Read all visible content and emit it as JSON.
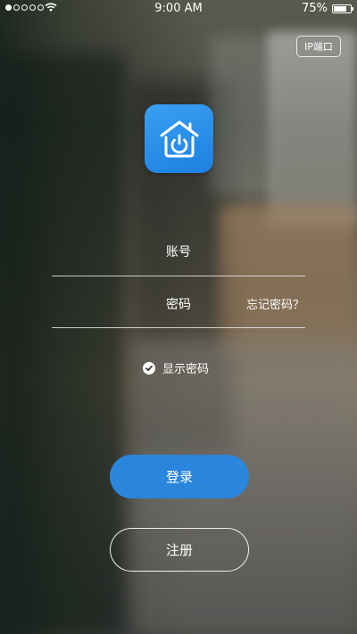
{
  "status_bar": {
    "time": "9:00 AM",
    "battery_percent": "75%",
    "battery_level": 0.75,
    "signal_dots_filled": 1,
    "signal_dots_total": 5
  },
  "header": {
    "ip_port_label": "IP端口"
  },
  "app_icon": {
    "icon": "home-power-icon",
    "color": "#2a86dc"
  },
  "form": {
    "account_label": "账号",
    "password_label": "密码",
    "forgot_password_label": "忘记密码？",
    "show_password_label": "显示密码",
    "show_password_checked": true
  },
  "actions": {
    "login_label": "登录",
    "register_label": "注册"
  },
  "colors": {
    "primary": "#2a86dc",
    "text": "#ffffff"
  }
}
